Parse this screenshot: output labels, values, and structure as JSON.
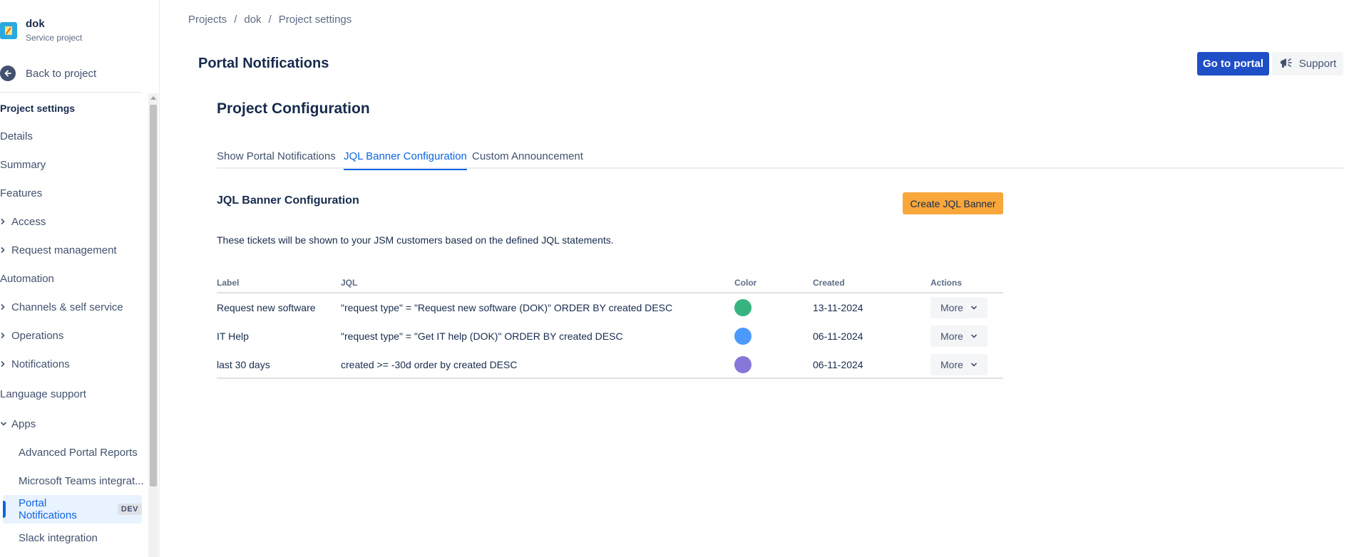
{
  "project": {
    "name": "dok",
    "type": "Service project"
  },
  "sidebar": {
    "back_label": "Back to project",
    "heading": "Project settings",
    "items": [
      {
        "label": "Details"
      },
      {
        "label": "Summary"
      },
      {
        "label": "Features"
      },
      {
        "label": "Access"
      },
      {
        "label": "Request management"
      },
      {
        "label": "Automation"
      },
      {
        "label": "Channels & self service"
      },
      {
        "label": "Operations"
      },
      {
        "label": "Notifications"
      },
      {
        "label": "Language support"
      },
      {
        "label": "Apps"
      },
      {
        "label": "Advanced Portal Reports"
      },
      {
        "label": "Microsoft Teams integrat..."
      },
      {
        "label": "Portal Notifications",
        "badge": "DEV"
      },
      {
        "label": "Slack integration"
      }
    ]
  },
  "breadcrumb": [
    "Projects",
    "dok",
    "Project settings"
  ],
  "header": {
    "title": "Portal Notifications",
    "go_portal_label": "Go to portal",
    "support_label": "Support"
  },
  "main": {
    "section_title": "Project Configuration",
    "tabs": [
      {
        "label": "Show Portal Notifications"
      },
      {
        "label": "JQL Banner Configuration"
      },
      {
        "label": "Custom Announcement"
      }
    ],
    "config_title": "JQL Banner Configuration",
    "create_label": "Create JQL Banner",
    "description": "These tickets will be shown to your JSM customers based on the defined JQL statements.",
    "table": {
      "columns": [
        "Label",
        "JQL",
        "Color",
        "Created",
        "Actions"
      ],
      "rows": [
        {
          "label": "Request new software",
          "jql": "\"request type\" = \"Request new software (DOK)\" ORDER BY created DESC",
          "color": "#36b37e",
          "created": "13-11-2024",
          "action": "More"
        },
        {
          "label": "IT Help",
          "jql": "\"request type\" = \"Get IT help (DOK)\" ORDER BY created DESC",
          "color": "#4c9aff",
          "created": "06-11-2024",
          "action": "More"
        },
        {
          "label": "last 30 days",
          "jql": "created >= -30d order by created DESC",
          "color": "#8777d9",
          "created": "06-11-2024",
          "action": "More"
        }
      ]
    }
  },
  "colors": {
    "primary": "#1f4fc6",
    "accent": "#f8a73a",
    "active_link": "#0c66e4"
  }
}
